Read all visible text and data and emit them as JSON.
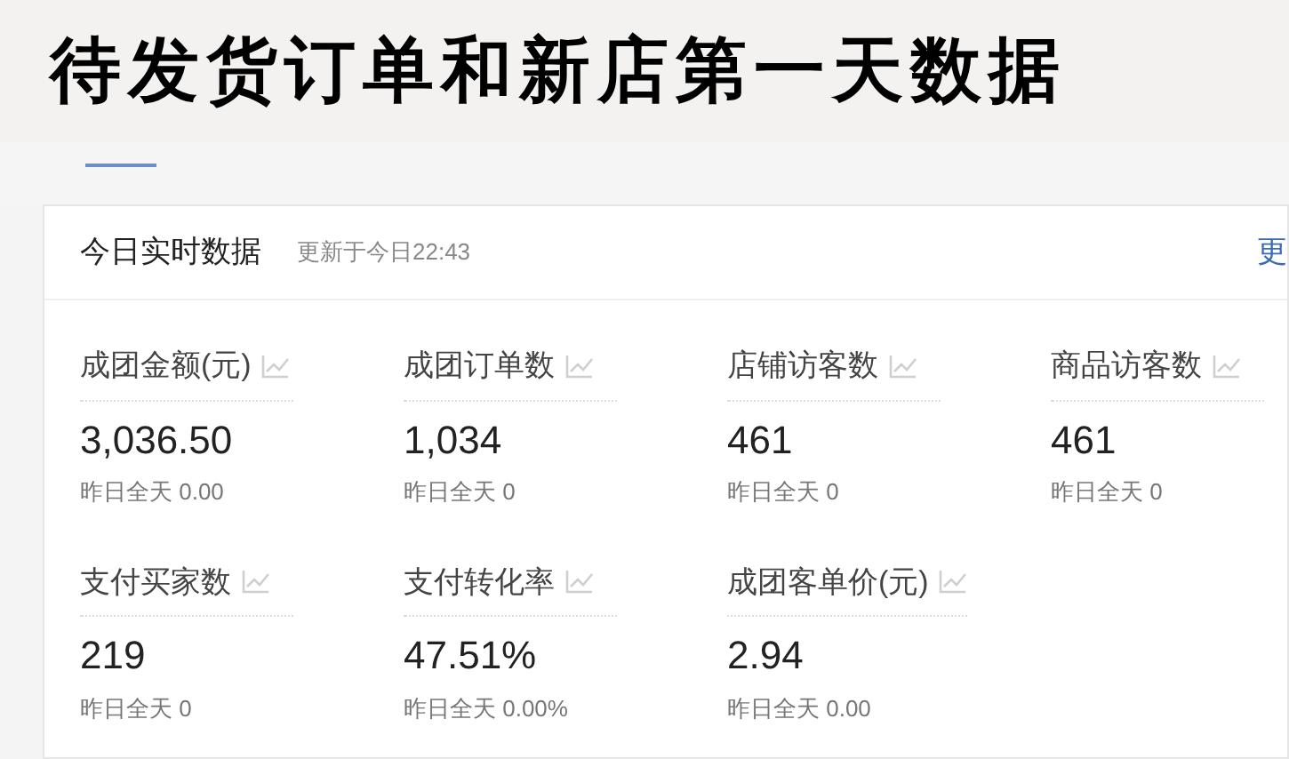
{
  "banner": {
    "title": "待发货订单和新店第一天数据"
  },
  "card": {
    "title": "今日实时数据",
    "updated": "更新于今日22:43",
    "more_link": "更",
    "metrics": [
      {
        "label": "成团金额(元)",
        "value": "3,036.50",
        "yesterday": "昨日全天 0.00"
      },
      {
        "label": "成团订单数",
        "value": "1,034",
        "yesterday": "昨日全天 0"
      },
      {
        "label": "店铺访客数",
        "value": "461",
        "yesterday": "昨日全天 0"
      },
      {
        "label": "商品访客数",
        "value": "461",
        "yesterday": "昨日全天 0"
      },
      {
        "label": "支付买家数",
        "value": "219",
        "yesterday": "昨日全天 0"
      },
      {
        "label": "支付转化率",
        "value": "47.51%",
        "yesterday": "昨日全天 0.00%"
      },
      {
        "label": "成团客单价(元)",
        "value": "2.94",
        "yesterday": "昨日全天 0.00"
      }
    ]
  }
}
